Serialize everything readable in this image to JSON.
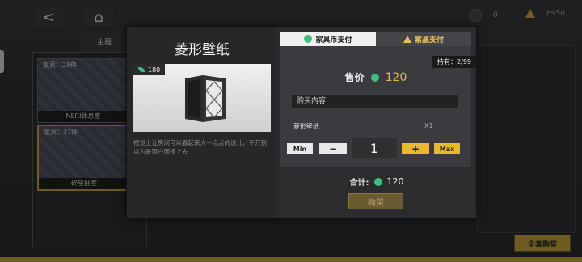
{
  "topbar": {
    "back_glyph": "<",
    "home_glyph": "⌂",
    "currency_coin_value": "0",
    "currency_crystal_value": "8950"
  },
  "left_tab": {
    "label": "主题"
  },
  "rooms": [
    {
      "count_label": "家具：28件",
      "name": "NERI休息室"
    },
    {
      "count_label": "家具：37件",
      "name": "碎星卧室"
    }
  ],
  "suit_buy_label": "全套购买",
  "dialog": {
    "title": "菱形壁纸",
    "item_count": "180",
    "description": "视觉上让房间可以看起来大一点点的设计。千万别以为是窗户而撞上去",
    "tabs": [
      {
        "label": "家具币支付",
        "icon": "leaf-coin-icon",
        "active": true
      },
      {
        "label": "紫晶支付",
        "icon": "crystal-triangle-icon",
        "active": false
      }
    ],
    "owned": "持有：2/99",
    "price_label": "售价",
    "price_value": "120",
    "buy_content_label": "购买内容",
    "item_name": "菱形壁纸",
    "item_qty": "X1",
    "min_label": "Min",
    "minus_glyph": "−",
    "quantity": "1",
    "plus_glyph": "+",
    "max_label": "Max",
    "total_label": "合计:",
    "total_value": "120",
    "buy_button": "购买"
  },
  "colors": {
    "accent_gold": "#e6b84a",
    "coin_green": "#3fbf7f"
  }
}
